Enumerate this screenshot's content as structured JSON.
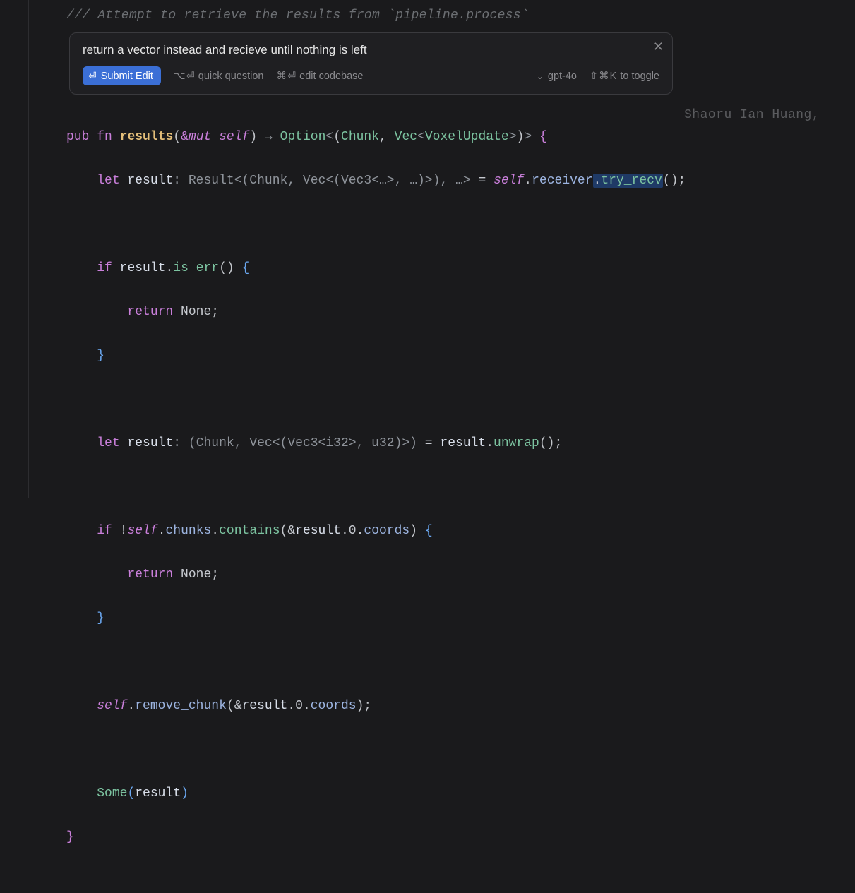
{
  "comment": "/// Attempt to retrieve the results from `pipeline.process`",
  "prompt": {
    "text": "return a vector instead and recieve until nothing is left",
    "submit_label": "Submit Edit",
    "quick_question_keys": "⌥⏎",
    "quick_question_label": "quick question",
    "edit_codebase_keys": "⌘⏎",
    "edit_codebase_label": "edit codebase",
    "model": "gpt-4o",
    "toggle_keys": "⇧⌘K",
    "toggle_label": "to toggle"
  },
  "blame": "Shaoru Ian Huang,",
  "code": {
    "l1": {
      "pub": "pub",
      "fn": "fn",
      "name": "results",
      "amp": "&",
      "mut": "mut",
      "self": "self",
      "arrow": "→",
      "Option": "Option",
      "Chunk": "Chunk",
      "Vec": "Vec",
      "VoxelUpdate": "VoxelUpdate"
    },
    "l2": {
      "let": "let",
      "result": "result",
      "Result": "Result",
      "Chunk": "Chunk",
      "Vec": "Vec",
      "Vec3": "Vec3",
      "dots": "…",
      "selftxt": "self",
      "receiver": "receiver",
      "try_recv": "try_recv"
    },
    "l3": {
      "if": "if",
      "result": "result",
      "is_err": "is_err"
    },
    "l4": {
      "return": "return",
      "None": "None"
    },
    "l6": {
      "let": "let",
      "result": "result",
      "Chunk": "Chunk",
      "Vec": "Vec",
      "Vec3": "Vec3",
      "i32": "i32",
      "u32": "u32",
      "resultr": "result",
      "unwrap": "unwrap"
    },
    "l7": {
      "if": "if",
      "self": "self",
      "chunks": "chunks",
      "contains": "contains",
      "result": "result",
      "zero": "0",
      "coords": "coords"
    },
    "l8": {
      "return": "return",
      "None": "None"
    },
    "l10": {
      "self": "self",
      "remove_chunk": "remove_chunk",
      "result": "result",
      "zero": "0",
      "coords": "coords"
    },
    "l11": {
      "Some": "Some",
      "result": "result"
    }
  }
}
